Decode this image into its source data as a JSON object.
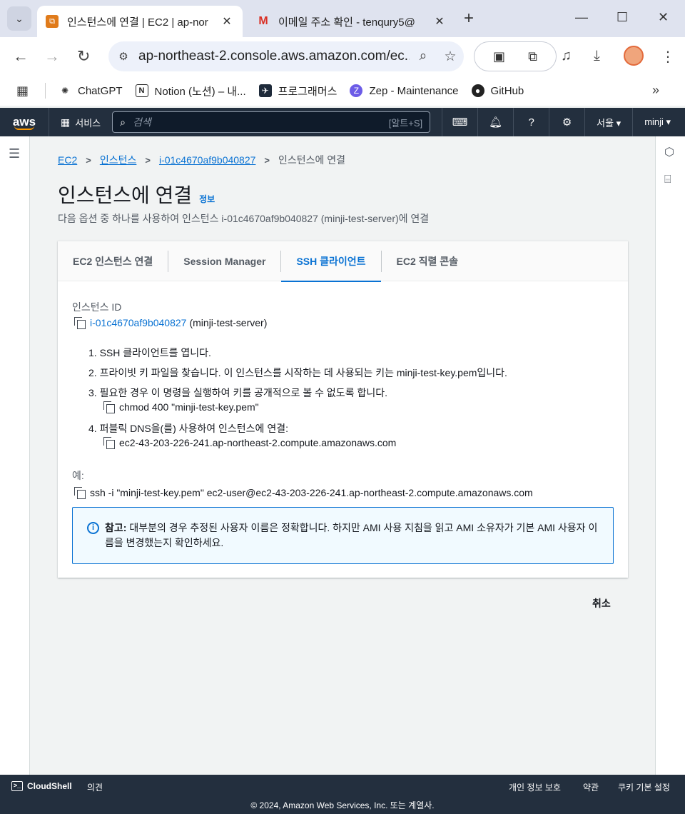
{
  "browser": {
    "tabs": [
      {
        "title": "인스턴스에 연결 | EC2 | ap-nor",
        "close": "✕"
      },
      {
        "title": "이메일 주소 확인 - tenqury5@",
        "close": "✕"
      }
    ],
    "new_tab": "+",
    "url": "ap-northeast-2.console.aws.amazon.com/ec...",
    "bookmarks": [
      "ChatGPT",
      "Notion (노션) – 내...",
      "프로그래머스",
      "Zep - Maintenance",
      "GitHub"
    ]
  },
  "aws_nav": {
    "logo": "aws",
    "services": "서비스",
    "search_placeholder": "검색",
    "search_shortcut": "[알트+S]",
    "region": "서울 ▾",
    "user": "minji ▾"
  },
  "breadcrumb": {
    "items": [
      "EC2",
      "인스턴스",
      "i-01c4670af9b040827"
    ],
    "current": "인스턴스에 연결"
  },
  "page": {
    "title": "인스턴스에 연결",
    "info_link": "정보",
    "subtitle": "다음 옵션 중 하나를 사용하여 인스턴스 i-01c4670af9b040827 (minji-test-server)에 연결"
  },
  "tabs": [
    {
      "label": "EC2 인스턴스 연결",
      "active": false
    },
    {
      "label": "Session Manager",
      "active": false
    },
    {
      "label": "SSH 클라이언트",
      "active": true
    },
    {
      "label": "EC2 직렬 콘솔",
      "active": false
    }
  ],
  "ssh": {
    "instance_id_label": "인스턴스 ID",
    "instance_id": "i-01c4670af9b040827",
    "instance_name": "(minji-test-server)",
    "steps": [
      "1. SSH 클라이언트를 엽니다.",
      "2. 프라이빗 키 파일을 찾습니다. 이 인스턴스를 시작하는 데 사용되는 키는 minji-test-key.pem입니다.",
      "3. 필요한 경우 이 명령을 실행하여 키를 공개적으로 볼 수 없도록 합니다.",
      "4. 퍼블릭 DNS을(를) 사용하여 인스턴스에 연결:"
    ],
    "chmod_cmd": "chmod 400 \"minji-test-key.pem\"",
    "public_dns": "ec2-43-203-226-241.ap-northeast-2.compute.amazonaws.com",
    "example_label": "예:",
    "example_cmd": "ssh -i \"minji-test-key.pem\" ec2-user@ec2-43-203-226-241.ap-northeast-2.compute.amazonaws.com",
    "note_label": "참고:",
    "note_text": "대부분의 경우 추정된 사용자 이름은 정확합니다. 하지만 AMI 사용 지침을 읽고 AMI 소유자가 기본 AMI 사용자 이름을 변경했는지 확인하세요."
  },
  "cancel_label": "취소",
  "footer": {
    "cloudshell": "CloudShell",
    "feedback": "의견",
    "privacy": "개인 정보 보호",
    "terms": "약관",
    "cookies": "쿠키 기본 설정",
    "copyright": "© 2024, Amazon Web Services, Inc. 또는 계열사."
  },
  "colors": {
    "aws_nav": "#232f3e",
    "link": "#0972d3",
    "note_bg": "#f1faff"
  }
}
